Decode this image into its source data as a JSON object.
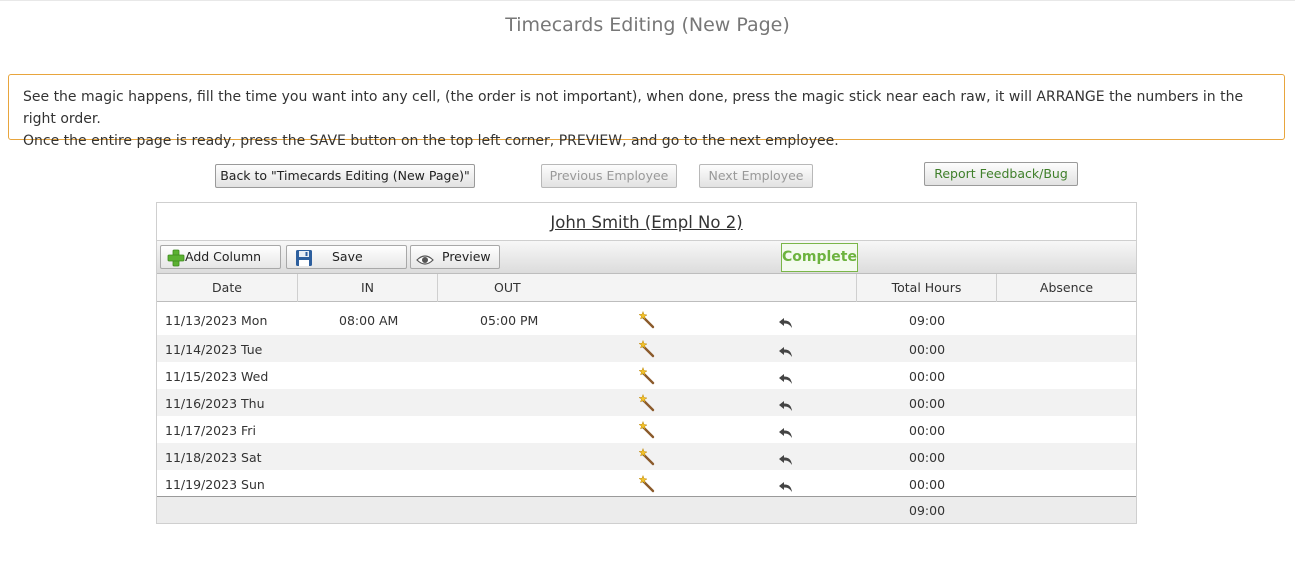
{
  "page": {
    "title": "Timecards Editing (New Page)"
  },
  "notice": {
    "line1": "See the magic happens, fill the time you want into any cell, (the order is not important), when done, press the magic stick near each raw, it will ARRANGE the numbers in the right order.",
    "line2": "Once the entire page is ready, press the SAVE button on the top left corner, PREVIEW, and go to the next employee."
  },
  "nav": {
    "back_label": "Back to \"Timecards Editing  (New Page)\"",
    "prev_label": "Previous Employee",
    "next_label": "Next Employee",
    "report_label": "Report Feedback/Bug"
  },
  "employee": {
    "name": "John Smith (Empl No 2)"
  },
  "toolbar": {
    "add_column_label": "Add Column",
    "save_label": "Save",
    "preview_label": "Preview",
    "complete_label": "Complete"
  },
  "table": {
    "headers": {
      "date": "Date",
      "in": "IN",
      "out": "OUT",
      "total": "Total Hours",
      "absence": "Absence"
    },
    "rows": [
      {
        "date": "11/13/2023 Mon",
        "in": "08:00 AM",
        "out": "05:00 PM",
        "total": "09:00"
      },
      {
        "date": "11/14/2023 Tue",
        "in": "",
        "out": "",
        "total": "00:00"
      },
      {
        "date": "11/15/2023 Wed",
        "in": "",
        "out": "",
        "total": "00:00"
      },
      {
        "date": "11/16/2023 Thu",
        "in": "",
        "out": "",
        "total": "00:00"
      },
      {
        "date": "11/17/2023 Fri",
        "in": "",
        "out": "",
        "total": "00:00"
      },
      {
        "date": "11/18/2023 Sat",
        "in": "",
        "out": "",
        "total": "00:00"
      },
      {
        "date": "11/19/2023 Sun",
        "in": "",
        "out": "",
        "total": "00:00"
      }
    ],
    "grand_total": "09:00"
  },
  "icons": {
    "add": "plus-icon",
    "save": "floppy-disk-icon",
    "preview": "eye-icon",
    "arrange": "magic-wand-icon",
    "revert": "undo-arrow-icon"
  },
  "colors": {
    "notice_border": "#e8a53d",
    "complete_green": "#6db33f",
    "report_text": "#3f7f2a"
  }
}
